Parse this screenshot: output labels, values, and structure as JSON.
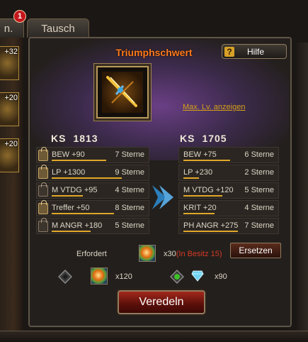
{
  "tabs": {
    "left_tab_partial": "n.",
    "tausch": "Tausch",
    "notification_count": "1"
  },
  "sidebar_slots": [
    "+32",
    "+20",
    "+20"
  ],
  "item": {
    "name": "Triumphschwert"
  },
  "help_label": "Hilfe",
  "help_icon": "question-icon",
  "max_lv_link": "Max. Lv. anzeigen",
  "current": {
    "ks_label": "KS",
    "ks_value": "1813",
    "stats": [
      {
        "name": "BEW +90",
        "stars": "7 Sterne",
        "locked": true,
        "level": 0.7
      },
      {
        "name": "LP +1300",
        "stars": "9 Sterne",
        "locked": true,
        "level": 0.9
      },
      {
        "name": "M VTDG +95",
        "stars": "4 Sterne",
        "locked": false,
        "level": 0.4
      },
      {
        "name": "Treffer +50",
        "stars": "8 Sterne",
        "locked": true,
        "level": 0.8
      },
      {
        "name": "M ANGR +180",
        "stars": "5 Sterne",
        "locked": false,
        "level": 0.5
      }
    ]
  },
  "result": {
    "ks_label": "KS",
    "ks_value": "1705",
    "stats": [
      {
        "name": "BEW +75",
        "stars": "6 Sterne",
        "level": 0.6
      },
      {
        "name": "LP +230",
        "stars": "2 Sterne",
        "level": 0.2
      },
      {
        "name": "M VTDG +120",
        "stars": "5 Sterne",
        "level": 0.5
      },
      {
        "name": "KRIT +20",
        "stars": "4 Sterne",
        "level": 0.4
      },
      {
        "name": "PH ANGR +275",
        "stars": "7 Sterne",
        "level": 0.7
      }
    ]
  },
  "requirement": {
    "label": "Erfordert",
    "count": "x30",
    "owned": "(In Besitz 15)",
    "replace_button": "Ersetzen"
  },
  "costs": {
    "orb_count": "x120",
    "diamond_count": "x90"
  },
  "refine_button": "Veredeln",
  "colors": {
    "title": "#ff7a1a",
    "link": "#d4a017",
    "star_bar": "#e0a72a",
    "owned_warning": "#d23b25",
    "arrow": "#2e8fd6"
  }
}
